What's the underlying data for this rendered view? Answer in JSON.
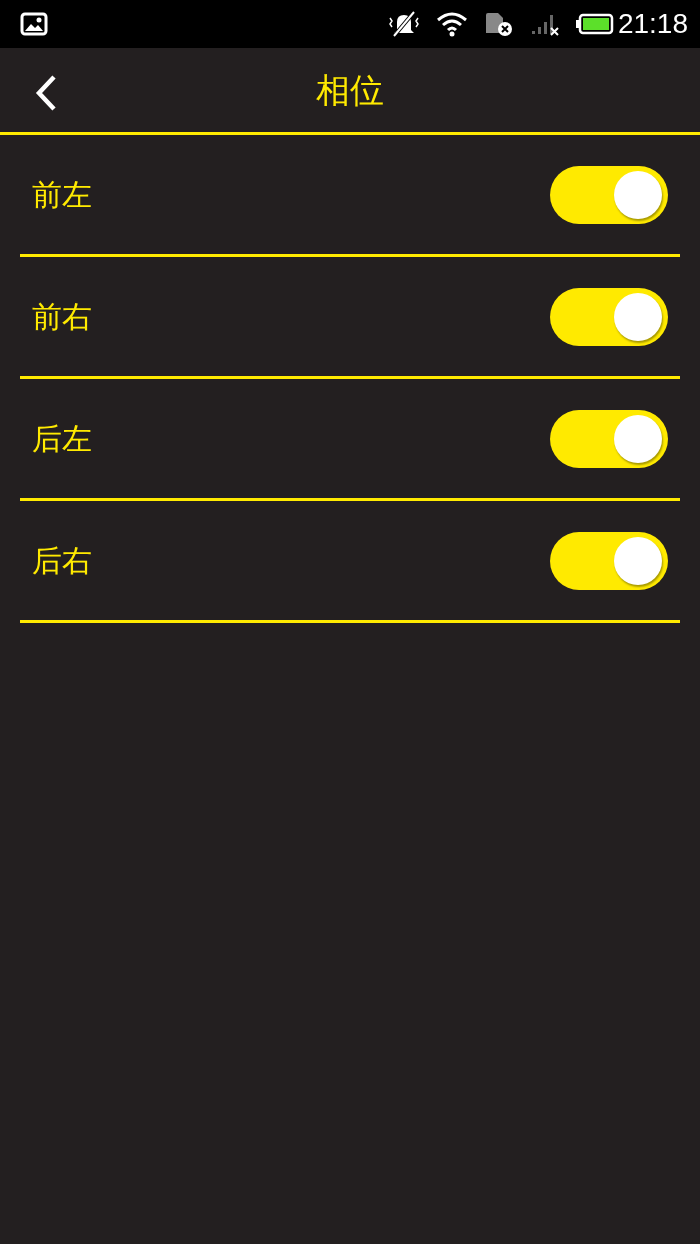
{
  "status_bar": {
    "time": "21:18"
  },
  "header": {
    "title": "相位"
  },
  "settings": [
    {
      "label": "前左",
      "on": true
    },
    {
      "label": "前右",
      "on": true
    },
    {
      "label": "后左",
      "on": true
    },
    {
      "label": "后右",
      "on": true
    }
  ]
}
